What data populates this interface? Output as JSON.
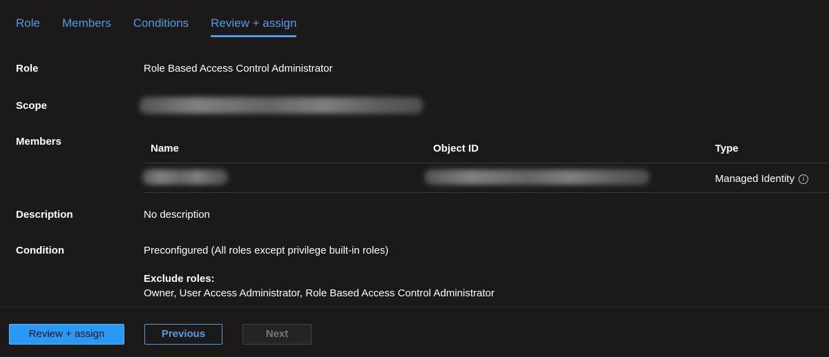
{
  "tabs": [
    {
      "label": "Role"
    },
    {
      "label": "Members"
    },
    {
      "label": "Conditions"
    },
    {
      "label": "Review + assign",
      "active": true
    }
  ],
  "details": {
    "role_label": "Role",
    "role_value": "Role Based Access Control Administrator",
    "scope_label": "Scope",
    "members_label": "Members",
    "description_label": "Description",
    "description_value": "No description",
    "condition_label": "Condition",
    "condition_value": "Preconfigured (All roles except privilege built-in roles)",
    "exclude_roles_label": "Exclude roles:",
    "exclude_roles_value": "Owner, User Access Administrator, Role Based Access Control Administrator"
  },
  "members_table": {
    "columns": [
      "Name",
      "Object ID",
      "Type"
    ],
    "rows": [
      {
        "type": "Managed Identity"
      }
    ]
  },
  "footer": {
    "primary_label": "Review + assign",
    "previous_label": "Previous",
    "next_label": "Next"
  },
  "colors": {
    "background": "#1b1a19",
    "accent": "#4f9de8",
    "primary_button": "#2899f5",
    "divider": "#3b3a39"
  },
  "icons": {
    "info": "info-icon"
  }
}
